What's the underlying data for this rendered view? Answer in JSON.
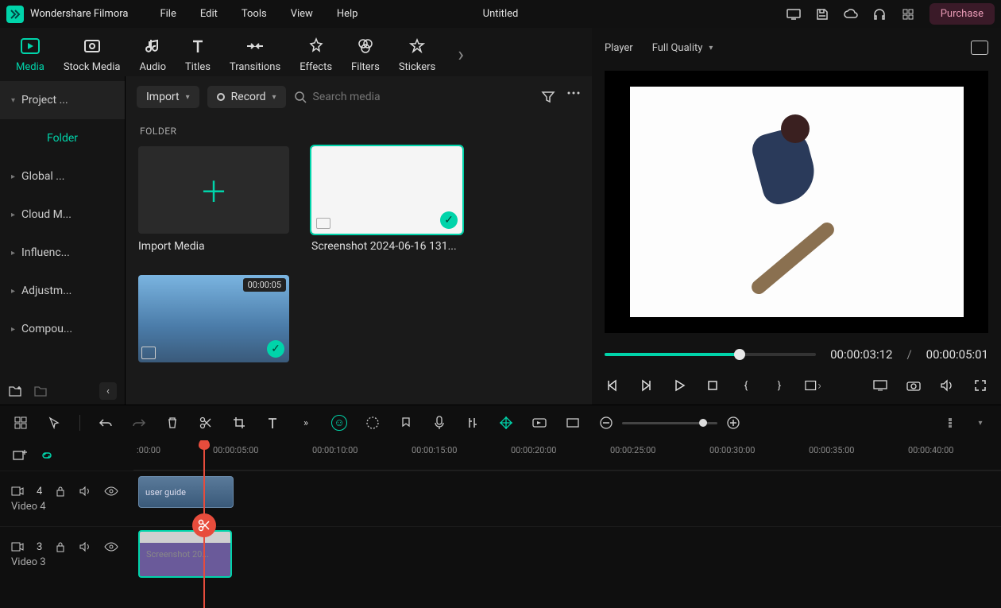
{
  "app": {
    "name": "Wondershare Filmora",
    "doc": "Untitled",
    "purchase": "Purchase"
  },
  "menu": [
    "File",
    "Edit",
    "Tools",
    "View",
    "Help"
  ],
  "nav": {
    "items": [
      "Media",
      "Stock Media",
      "Audio",
      "Titles",
      "Transitions",
      "Effects",
      "Filters",
      "Stickers"
    ],
    "active": 0
  },
  "sidebar": {
    "project": "Project ...",
    "folder": "Folder",
    "items": [
      "Global ...",
      "Cloud M...",
      "Influenc...",
      "Adjustm...",
      "Compou..."
    ]
  },
  "toolbar": {
    "import": "Import",
    "record": "Record",
    "search_placeholder": "Search media"
  },
  "folder_label": "FOLDER",
  "cards": {
    "import": "Import Media",
    "screenshot": "Screenshot 2024-06-16 131...",
    "video_duration": "00:00:05"
  },
  "player": {
    "label": "Player",
    "quality": "Full Quality",
    "current": "00:00:03:12",
    "total": "00:00:05:01",
    "sep": "/"
  },
  "timeline": {
    "ruler": [
      ":00:00",
      "00:00:05:00",
      "00:00:10:00",
      "00:00:15:00",
      "00:00:20:00",
      "00:00:25:00",
      "00:00:30:00",
      "00:00:35:00",
      "00:00:40:00"
    ],
    "tracks": [
      {
        "num": "4",
        "name": "Video 4",
        "clip_label": "user guide"
      },
      {
        "num": "3",
        "name": "Video 3",
        "clip_label": "Screenshot 20..."
      }
    ]
  }
}
